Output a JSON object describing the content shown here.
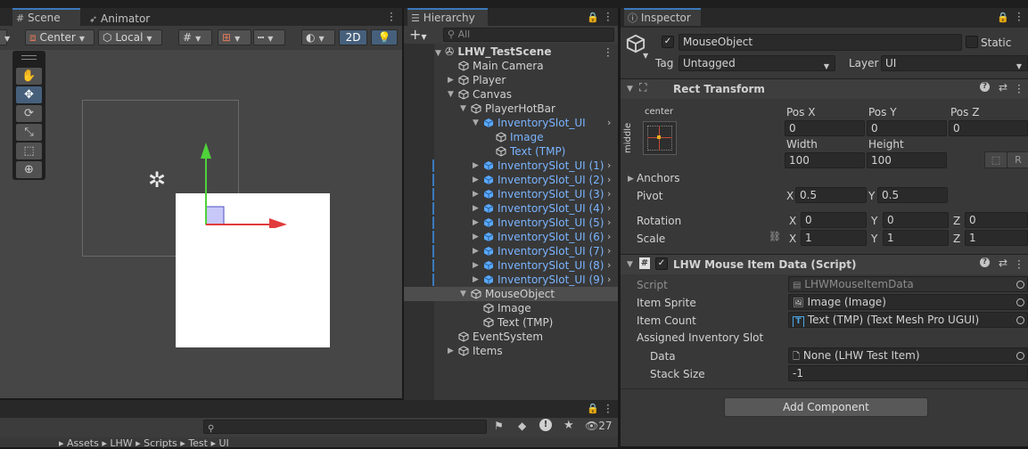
{
  "scene_panel": {
    "tabs": [
      {
        "label": "Scene"
      },
      {
        "label": "Animator"
      }
    ],
    "toolbar": {
      "pivot": "Center",
      "space": "Local",
      "mode_2d": "2D"
    }
  },
  "hierarchy": {
    "tab_label": "Hierarchy",
    "search_placeholder": "All",
    "scene_name": "LHW_TestScene",
    "items": [
      {
        "label": "Main Camera"
      },
      {
        "label": "Player"
      },
      {
        "label": "Canvas"
      },
      {
        "label": "PlayerHotBar"
      },
      {
        "label": "InventorySlot_UI"
      },
      {
        "label": "Image"
      },
      {
        "label": "Text (TMP)"
      },
      {
        "label": "InventorySlot_UI (1)"
      },
      {
        "label": "InventorySlot_UI (2)"
      },
      {
        "label": "InventorySlot_UI (3)"
      },
      {
        "label": "InventorySlot_UI (4)"
      },
      {
        "label": "InventorySlot_UI (5)"
      },
      {
        "label": "InventorySlot_UI (6)"
      },
      {
        "label": "InventorySlot_UI (7)"
      },
      {
        "label": "InventorySlot_UI (8)"
      },
      {
        "label": "InventorySlot_UI (9)"
      },
      {
        "label": "MouseObject"
      },
      {
        "label": "Image"
      },
      {
        "label": "Text (TMP)"
      },
      {
        "label": "EventSystem"
      },
      {
        "label": "Items"
      }
    ]
  },
  "inspector": {
    "tab_label": "Inspector",
    "object_name": "MouseObject",
    "static_label": "Static",
    "tag_label": "Tag",
    "tag_value": "Untagged",
    "layer_label": "Layer",
    "layer_value": "UI",
    "rect_transform": {
      "title": "Rect Transform",
      "anchor_h": "center",
      "anchor_v": "middle",
      "pos_x_label": "Pos X",
      "pos_y_label": "Pos Y",
      "pos_z_label": "Pos Z",
      "pos_x": "0",
      "pos_y": "0",
      "pos_z": "0",
      "width_label": "Width",
      "height_label": "Height",
      "width": "100",
      "height": "100",
      "r_button": "R",
      "anchors_label": "Anchors",
      "pivot_label": "Pivot",
      "pivot_x": "0.5",
      "pivot_y": "0.5",
      "rotation_label": "Rotation",
      "rot_x": "0",
      "rot_y": "0",
      "rot_z": "0",
      "scale_label": "Scale",
      "scale_x": "1",
      "scale_y": "1",
      "scale_z": "1",
      "x": "X",
      "y": "Y",
      "z": "Z"
    },
    "script_component": {
      "title": "LHW Mouse Item Data (Script)",
      "script_label": "Script",
      "script_value": "LHWMouseItemData",
      "item_sprite_label": "Item Sprite",
      "item_sprite_value": "Image (Image)",
      "item_count_label": "Item Count",
      "item_count_value": "Text (TMP) (Text Mesh Pro UGUI)",
      "assigned_label": "Assigned Inventory Slot",
      "data_label": "Data",
      "data_value": "None (LHW Test Item)",
      "stack_label": "Stack Size",
      "stack_value": "-1"
    },
    "add_component": "Add Component"
  },
  "project_panel": {
    "count": "27",
    "breadcrumb": [
      "Assets",
      "LHW",
      "Scripts",
      "Test",
      "UI"
    ]
  }
}
